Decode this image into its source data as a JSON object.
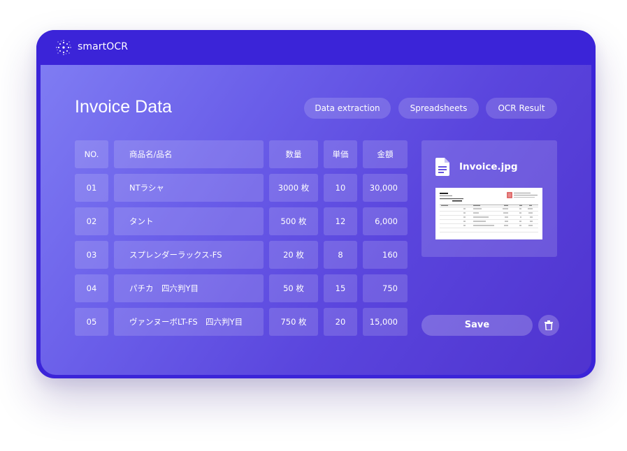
{
  "app": {
    "name": "smartOCR",
    "logo_icon": "sparkle-dots-icon"
  },
  "page": {
    "title": "Invoice Data"
  },
  "tabs": [
    "Data extraction",
    "Spreadsheets",
    "OCR Result"
  ],
  "table": {
    "headers": [
      "NO.",
      "商品名/品名",
      "数量",
      "単価",
      "金額"
    ],
    "rows": [
      {
        "no": "01",
        "name": "NTラシャ",
        "qty": "3000 枚",
        "price": "10",
        "amount": "30,000"
      },
      {
        "no": "02",
        "name": "タント",
        "qty": "500  枚",
        "price": "12",
        "amount": "6,000"
      },
      {
        "no": "03",
        "name": "スプレンダーラックス-FS",
        "qty": "20  枚",
        "price": "8",
        "amount": "160"
      },
      {
        "no": "04",
        "name": "パチカ　四六判Y目",
        "qty": "50  枚",
        "price": "15",
        "amount": "750"
      },
      {
        "no": "05",
        "name": "ヴァンヌーボLT-FS　四六判Y目",
        "qty": "750  枚",
        "price": "20",
        "amount": "15,000"
      }
    ]
  },
  "file": {
    "name": "Invoice.jpg",
    "icon": "document-icon"
  },
  "actions": {
    "save_label": "Save",
    "delete_icon": "trash-icon"
  },
  "colors": {
    "frame": "#3b24d8",
    "gradient_start": "#7f7cf3",
    "gradient_end": "#4f33cf",
    "text": "#ffffff"
  }
}
